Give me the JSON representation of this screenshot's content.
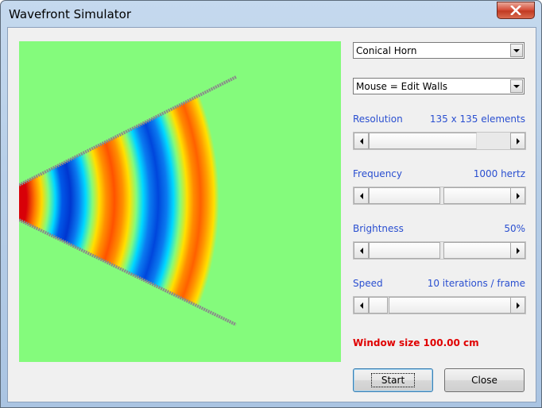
{
  "window": {
    "title": "Wavefront Simulator"
  },
  "controls": {
    "geometry_select": {
      "value": "Conical Horn"
    },
    "mouse_mode_select": {
      "value": "Mouse = Edit Walls"
    },
    "resolution": {
      "label": "Resolution",
      "value": "135 x 135 elements",
      "level": 0.76
    },
    "frequency": {
      "label": "Frequency",
      "value": "1000 hertz",
      "level": 0.5
    },
    "brightness": {
      "label": "Brightness",
      "value": "50%",
      "level": 0.5
    },
    "speed": {
      "label": "Speed",
      "value": "10 iterations / frame",
      "level": 0.05
    },
    "window_size": "Window size 100.00 cm"
  },
  "buttons": {
    "start": "Start",
    "close": "Close"
  },
  "colors": {
    "background_field": "#84fb7c",
    "label_blue": "#2a4fd0",
    "warning_red": "#e00000",
    "wall": "#8a8a8a"
  }
}
